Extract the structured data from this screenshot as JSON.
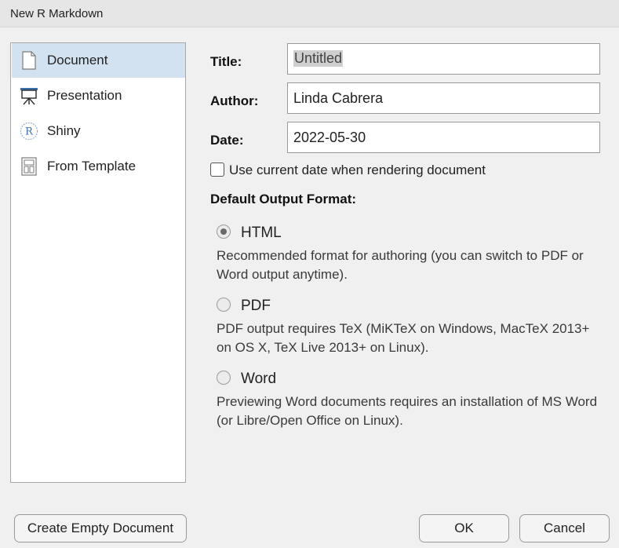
{
  "window": {
    "title": "New R Markdown"
  },
  "sidebar": {
    "items": [
      {
        "label": "Document",
        "icon": "document-icon",
        "selected": true
      },
      {
        "label": "Presentation",
        "icon": "presentation-icon",
        "selected": false
      },
      {
        "label": "Shiny",
        "icon": "shiny-r-icon",
        "selected": false
      },
      {
        "label": "From Template",
        "icon": "template-icon",
        "selected": false
      }
    ]
  },
  "form": {
    "title_label": "Title:",
    "title_value": "Untitled",
    "author_label": "Author:",
    "author_value": "Linda Cabrera",
    "date_label": "Date:",
    "date_value": "2022-05-30",
    "use_current_date_label": "Use current date when rendering document",
    "use_current_date_checked": false,
    "output_format_label": "Default Output Format:",
    "formats": [
      {
        "label": "HTML",
        "checked": true,
        "description": "Recommended format for authoring (you can switch to PDF or Word output anytime)."
      },
      {
        "label": "PDF",
        "checked": false,
        "description": "PDF output requires TeX (MiKTeX on Windows, MacTeX 2013+ on OS X, TeX Live 2013+ on Linux)."
      },
      {
        "label": "Word",
        "checked": false,
        "description": "Previewing Word documents requires an installation of MS Word (or Libre/Open Office on Linux)."
      }
    ]
  },
  "buttons": {
    "create_empty": "Create Empty Document",
    "ok": "OK",
    "cancel": "Cancel"
  },
  "colors": {
    "selected_item_bg": "#d3e2f0",
    "shiny_blue": "#3a6fb0"
  }
}
